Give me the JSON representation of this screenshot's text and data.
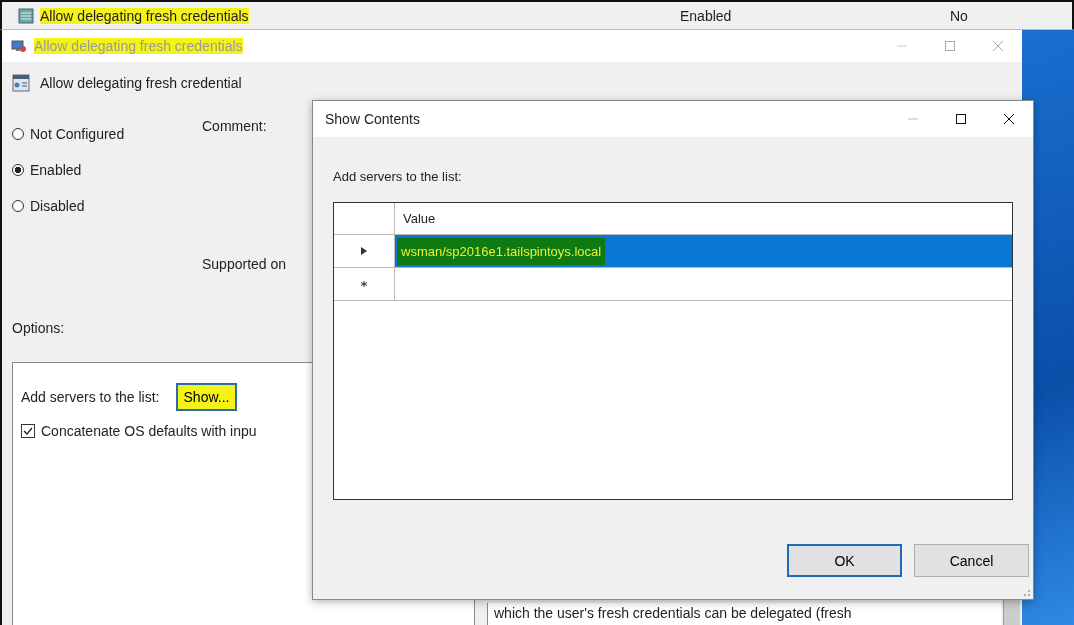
{
  "policy_row": {
    "name": "Allow delegating fresh credentials",
    "highlighted": true,
    "state": "Enabled",
    "comment": "No"
  },
  "window": {
    "title": "Allow delegating fresh credentials",
    "highlighted": true
  },
  "policy": {
    "heading": "Allow delegating fresh credential",
    "radios": [
      {
        "label": "Not Configured",
        "selected": false
      },
      {
        "label": "Enabled",
        "selected": true
      },
      {
        "label": "Disabled",
        "selected": false
      }
    ],
    "comment_label": "Comment:",
    "supported_label": "Supported on",
    "options_label": "Options:",
    "option_label": "Add servers to the list:",
    "show_button": {
      "label": "Show...",
      "highlighted": true
    },
    "checkbox": {
      "label": "Concatenate OS defaults with inpu",
      "checked": true
    },
    "help_text": "which the user's fresh credentials can be delegated (fresh"
  },
  "dialog": {
    "title": "Show Contents",
    "prompt": "Add servers to the list:",
    "column": "Value",
    "rows": [
      {
        "kind": "current",
        "value": "wsman/sp2016e1.tailspintoys.local",
        "selected": true,
        "highlighted": true
      },
      {
        "kind": "new",
        "selected": false
      }
    ],
    "buttons": [
      {
        "label": "OK",
        "default": true
      },
      {
        "label": "Cancel",
        "default": false
      }
    ]
  }
}
